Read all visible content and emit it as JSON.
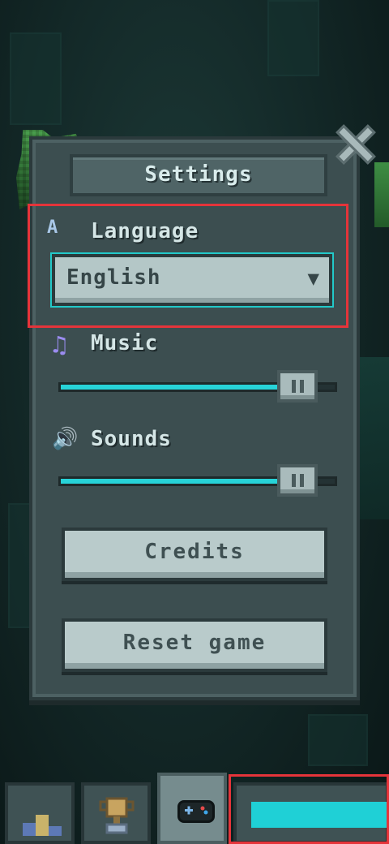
{
  "settings": {
    "title": "Settings",
    "language": {
      "label": "Language",
      "icon_text": "A",
      "selected": "English"
    },
    "music": {
      "label": "Music",
      "level": 0.92
    },
    "sounds": {
      "label": "Sounds",
      "level": 0.92
    },
    "buttons": {
      "credits": "Credits",
      "reset": "Reset game"
    }
  },
  "bottom_nav": {
    "tabs": [
      {
        "icon": "trophy-podium-icon",
        "active": false
      },
      {
        "icon": "cup-icon",
        "active": false
      },
      {
        "icon": "gamepad-icon",
        "active": true
      },
      {
        "icon": "settings-tab",
        "active": false
      }
    ]
  },
  "colors": {
    "accent_cyan": "#27d3d8",
    "highlight_red": "#e5343a",
    "panel": "#3c4e50"
  }
}
